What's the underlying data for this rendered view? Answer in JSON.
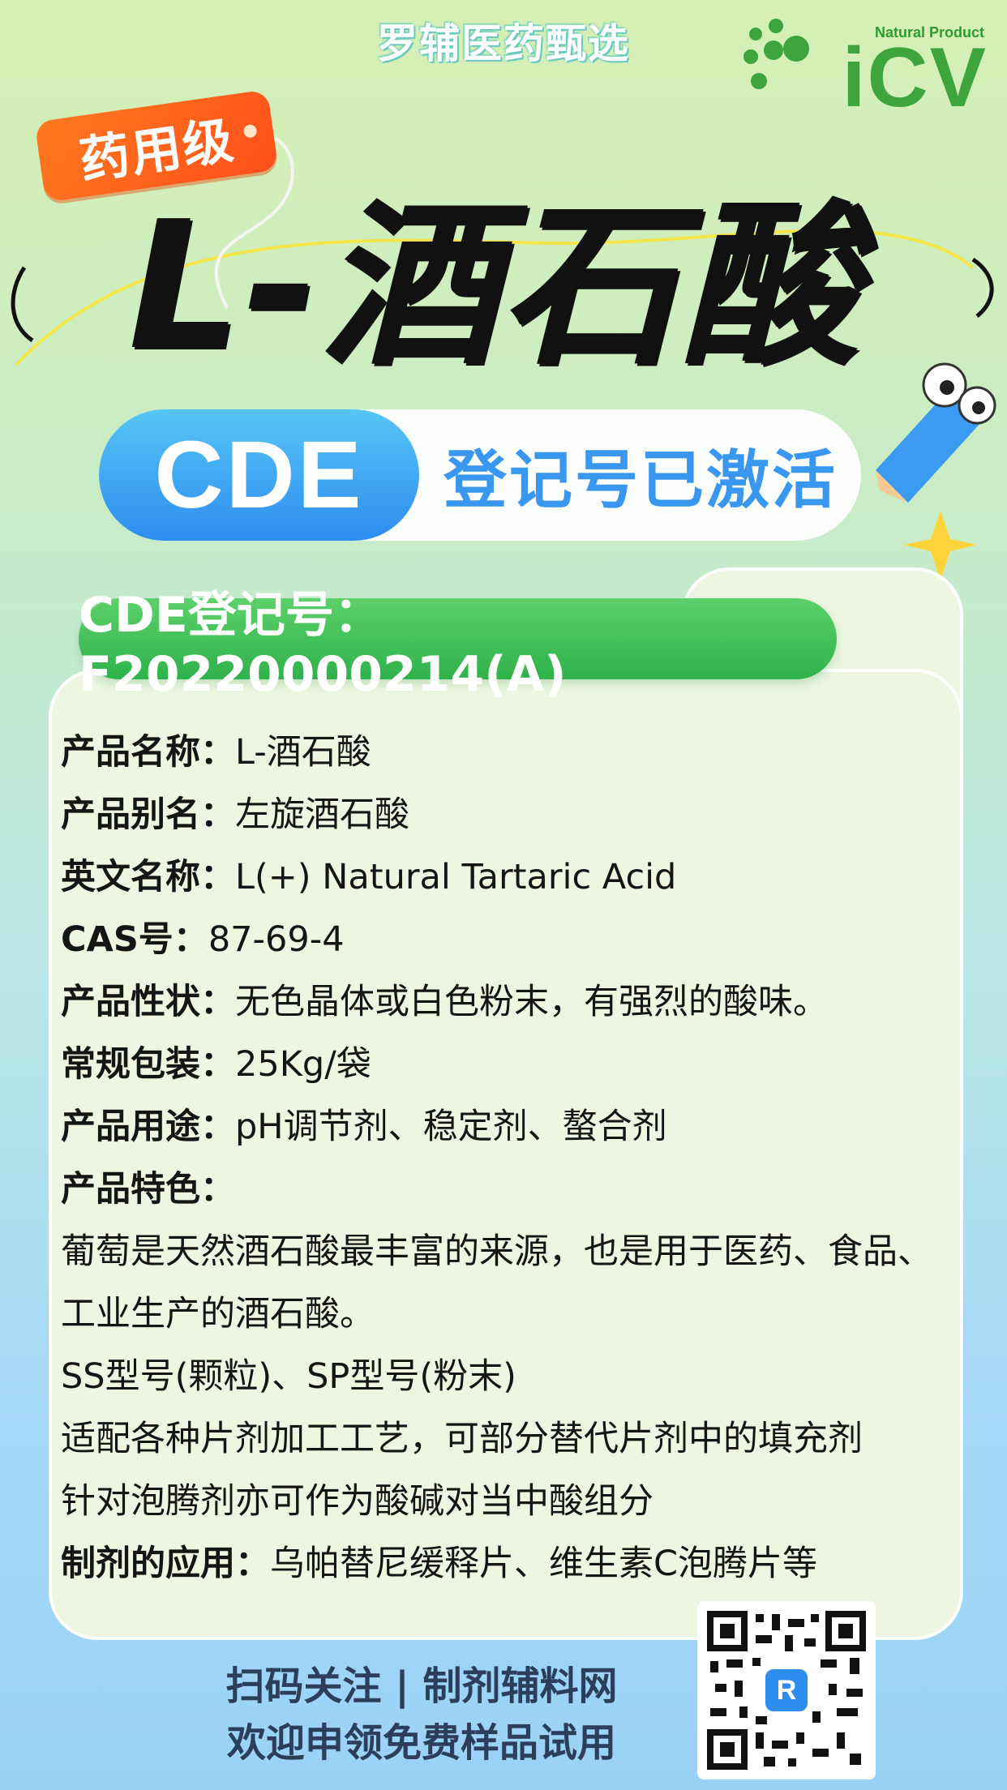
{
  "header": {
    "brand": "罗辅医药甄选",
    "logo_sub": "Natural Product",
    "logo_main": "iCV",
    "tag": "药用级"
  },
  "title": "L-酒石酸",
  "cde": {
    "pill": "CDE",
    "text": "登记号已激活",
    "registration": "CDE登记号：F20220000214(A)"
  },
  "info": {
    "rows": [
      {
        "key": "产品名称：",
        "value": "L-酒石酸"
      },
      {
        "key": "产品别名：",
        "value": "左旋酒石酸"
      },
      {
        "key": "英文名称：",
        "value": "L(+) Natural Tartaric Acid"
      },
      {
        "key": "CAS号：",
        "value": "87-69-4"
      },
      {
        "key": "产品性状：",
        "value": "无色晶体或白色粉末，有强烈的酸味。"
      },
      {
        "key": "常规包装：",
        "value": "25Kg/袋"
      },
      {
        "key": "产品用途：",
        "value": "pH调节剂、稳定剂、螯合剂"
      },
      {
        "key": "产品特色：",
        "value": ""
      }
    ],
    "features": [
      "葡萄是天然酒石酸最丰富的来源，也是用于医药、食品、工业生产的酒石酸。",
      "SS型号(颗粒)、SP型号(粉末)",
      "适配各种片剂加工工艺，可部分替代片剂中的填充剂",
      "针对泡腾剂亦可作为酸碱对当中酸组分"
    ],
    "application": {
      "key": "制剂的应用：",
      "value": "乌帕替尼缓释片、维生素C泡腾片等"
    }
  },
  "footer": {
    "line1": "扫码关注 | 制剂辅料网",
    "line2": "欢迎申领免费样品试用",
    "qr_center": "R"
  },
  "colors": {
    "accent_blue": "#3a97ef",
    "accent_green": "#3ea53e",
    "tag_orange": "#ff5a1a"
  }
}
